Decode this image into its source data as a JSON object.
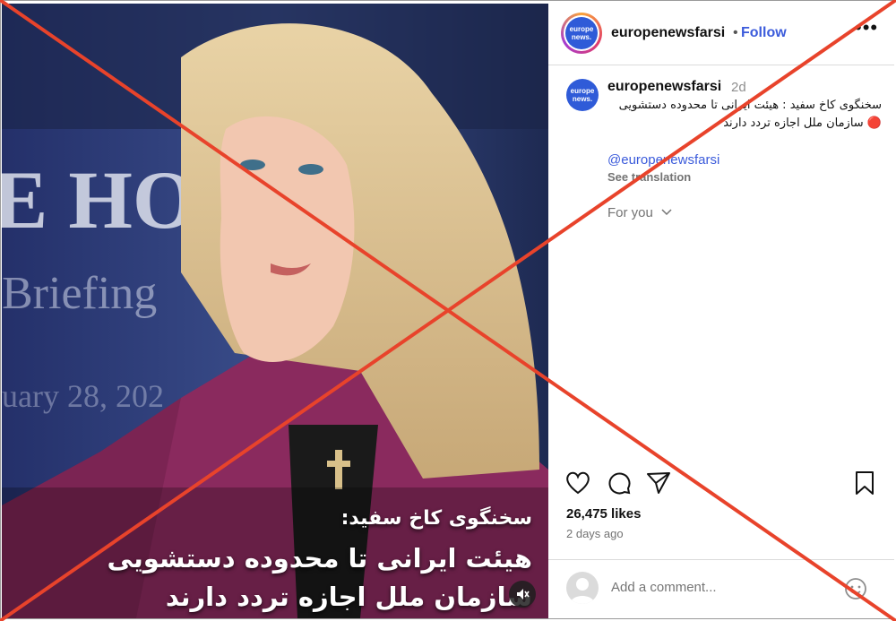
{
  "post": {
    "media": {
      "sign_text_1": "E HOUS",
      "sign_text_2": "Briefing",
      "sign_text_3": "uary 28, 202",
      "caption_line1": "سخنگوی کاخ سفید:",
      "caption_line2": "هیئت ایرانی تا محدوده دستشویی",
      "caption_line3": "سازمان ملل اجازه تردد دارند",
      "mute_icon": "speaker-muted-icon"
    },
    "header": {
      "username": "europenewsfarsi",
      "separator": "•",
      "follow_label": "Follow",
      "more_label": "•••",
      "logo_line1": "europe",
      "logo_line2": "news."
    },
    "caption": {
      "username": "europenewsfarsi",
      "time": "2d",
      "text": "سخنگوی کاخ سفید :  هیئت ایرانی تا محدوده دستشویی 🔴 سازمان ملل اجازه تردد دارند",
      "mention": "@europenewsfarsi",
      "see_translation": "See translation",
      "for_you": "For you"
    },
    "likes": "26,475 likes",
    "posted": "2 days ago",
    "comment_placeholder": "Add a comment..."
  },
  "overlay": {
    "x_color": "#e8432b"
  }
}
